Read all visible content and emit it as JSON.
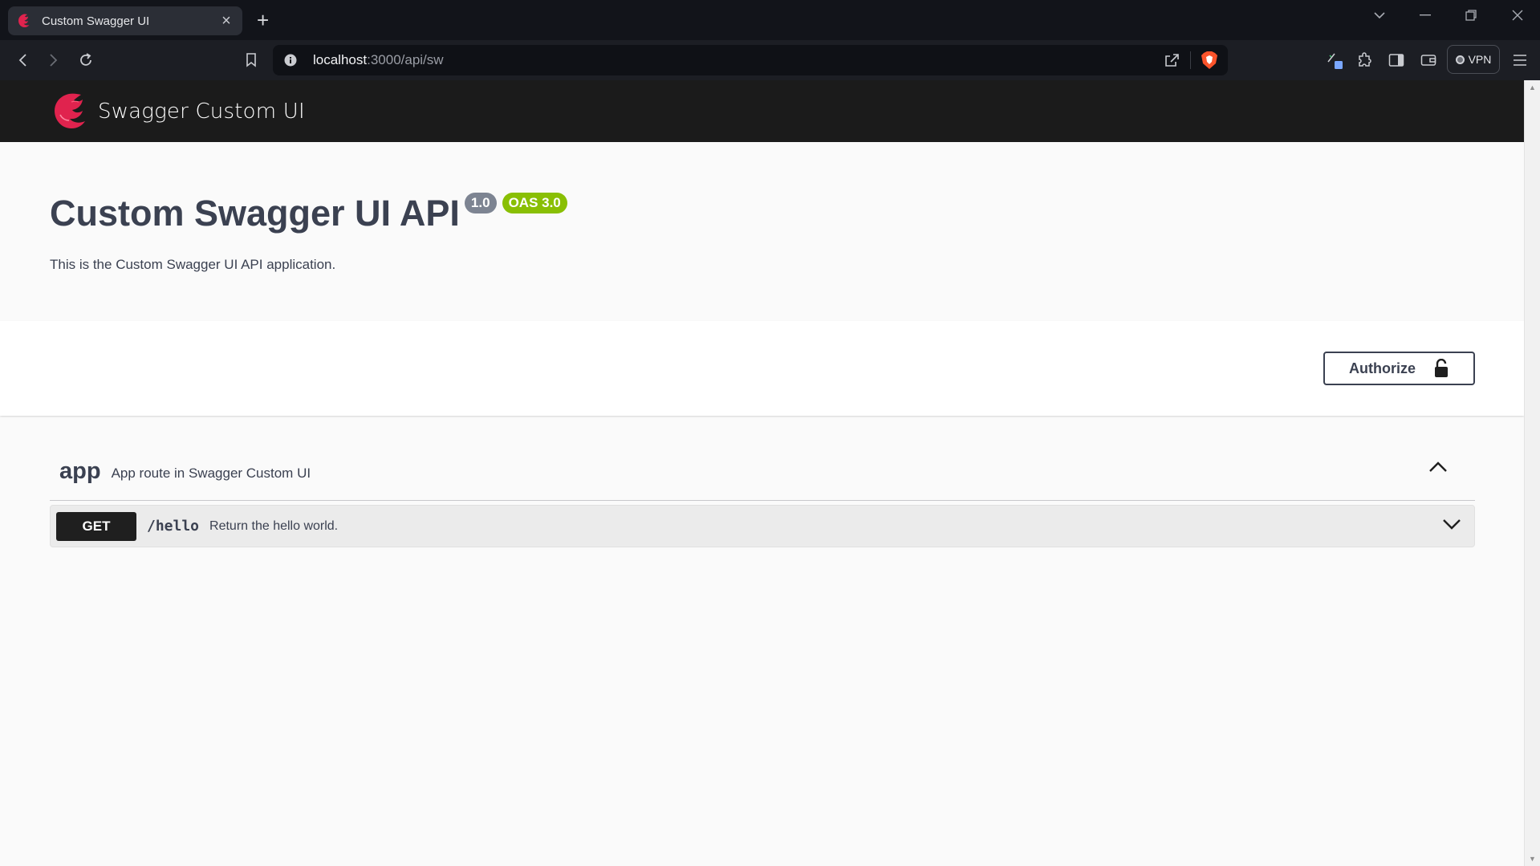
{
  "browser": {
    "tab_title": "Custom Swagger UI",
    "tab_close": "×",
    "new_tab": "+",
    "url_host": "localhost",
    "url_path": ":3000/api/sw",
    "vpn_label": "VPN",
    "window_controls": [
      "chevron-down-icon",
      "minimize-icon",
      "restore-icon",
      "close-icon"
    ]
  },
  "header": {
    "brand_name": "Swagger Custom UI",
    "brand_color": "#e0234e"
  },
  "info": {
    "title": "Custom Swagger UI API",
    "version": "1.0",
    "oas": "OAS 3.0",
    "description": "This is the Custom Swagger UI API application."
  },
  "auth": {
    "label": "Authorize"
  },
  "tag": {
    "name": "app",
    "description": "App route in Swagger Custom UI",
    "operations": [
      {
        "method": "GET",
        "path": "/hello",
        "summary": "Return the hello world."
      }
    ]
  },
  "colors": {
    "topbar": "#1b1b1b",
    "method_get": "#1f1f1f",
    "oas_badge": "#89bf04",
    "version_badge": "#7d8492",
    "text": "#3b4151"
  }
}
